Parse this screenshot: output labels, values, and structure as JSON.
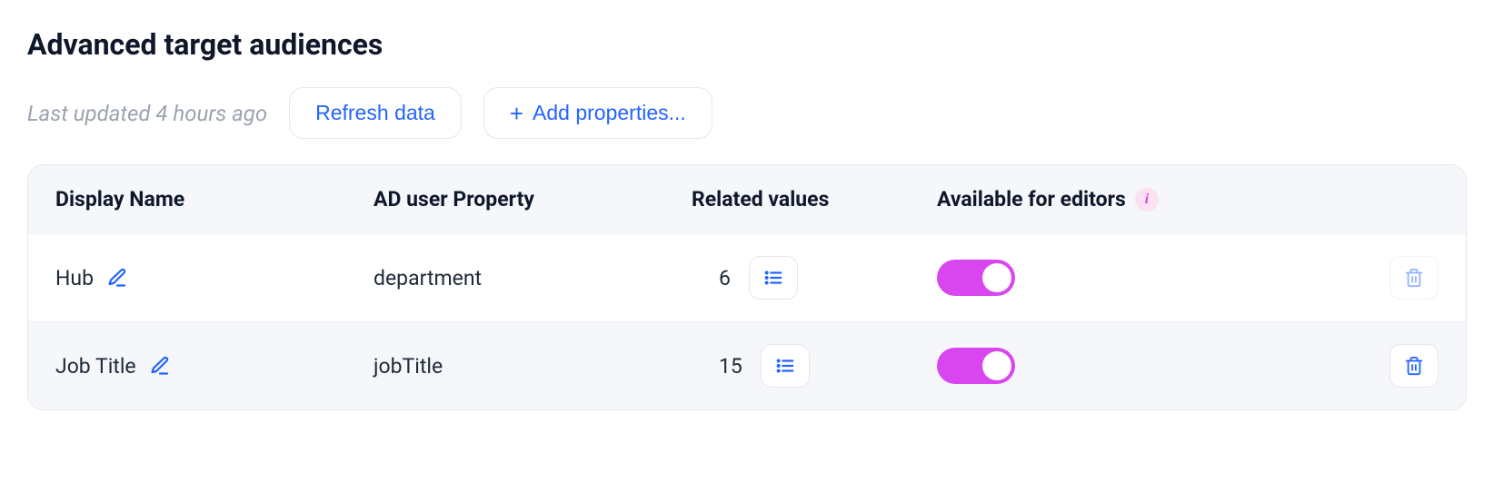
{
  "header": {
    "title": "Advanced target audiences",
    "last_updated": "Last updated 4 hours ago",
    "refresh_label": "Refresh data",
    "add_label": "Add properties..."
  },
  "table": {
    "columns": {
      "display_name": "Display Name",
      "ad_property": "AD user Property",
      "related_values": "Related values",
      "available_for_editors": "Available for editors"
    },
    "rows": [
      {
        "display_name": "Hub",
        "ad_property": "department",
        "related_values": "6",
        "available_for_editors": true
      },
      {
        "display_name": "Job Title",
        "ad_property": "jobTitle",
        "related_values": "15",
        "available_for_editors": true
      }
    ]
  }
}
